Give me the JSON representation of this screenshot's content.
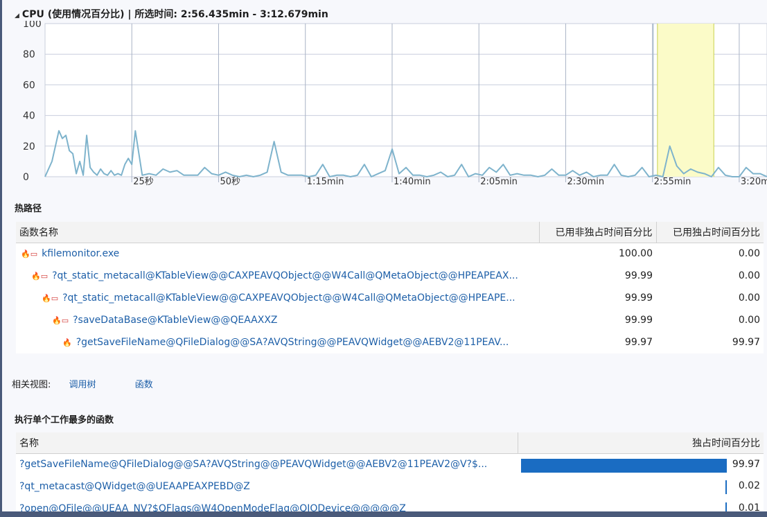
{
  "chart": {
    "title": "CPU (使用情况百分比) | 所选时间: 2:56.435min - 3:12.679min",
    "y_ticks": [
      "100",
      "80",
      "60",
      "40",
      "20",
      "0"
    ],
    "x_ticks": [
      "25秒",
      "50秒",
      "1:15min",
      "1:40min",
      "2:05min",
      "2:30min",
      "2:55min",
      "3:20min"
    ]
  },
  "chart_data": {
    "type": "line",
    "title": "CPU (使用情况百分比)",
    "xlabel": "",
    "ylabel": "",
    "ylim": [
      0,
      100
    ],
    "xlim_seconds": [
      0,
      208
    ],
    "selection_seconds": [
      176.435,
      192.679
    ],
    "x_unit": "seconds",
    "x": [
      0,
      2,
      4,
      5,
      6,
      7,
      8,
      9,
      10,
      11,
      12,
      13,
      14,
      15,
      16,
      17,
      18,
      19,
      20,
      21,
      22,
      23,
      24,
      25,
      26,
      28,
      30,
      32,
      34,
      36,
      38,
      40,
      44,
      46,
      48,
      50,
      52,
      54,
      56,
      58,
      60,
      62,
      64,
      66,
      68,
      70,
      72,
      74,
      76,
      78,
      80,
      82,
      84,
      86,
      88,
      90,
      92,
      94,
      96,
      98,
      100,
      102,
      104,
      106,
      108,
      110,
      112,
      114,
      116,
      118,
      120,
      122,
      124,
      126,
      128,
      130,
      132,
      134,
      136,
      138,
      140,
      142,
      144,
      146,
      148,
      150,
      152,
      154,
      156,
      158,
      160,
      162,
      164,
      166,
      168,
      170,
      172,
      174,
      176,
      178,
      180,
      182,
      184,
      186,
      188,
      190,
      192,
      194,
      196,
      198,
      200,
      202,
      204,
      206,
      208
    ],
    "series": [
      {
        "values": [
          0,
          10,
          30,
          25,
          27,
          17,
          15,
          2,
          10,
          1,
          27,
          6,
          3,
          1,
          5,
          2,
          1,
          4,
          1,
          2,
          1,
          8,
          12,
          8,
          30,
          1,
          2,
          1,
          5,
          3,
          4,
          1,
          1,
          6,
          2,
          1,
          3,
          1,
          0,
          1,
          0,
          1,
          3,
          23,
          3,
          1,
          1,
          1,
          0,
          1,
          8,
          0,
          1,
          1,
          0,
          1,
          8,
          0,
          2,
          4,
          18,
          2,
          6,
          1,
          1,
          0,
          1,
          3,
          0,
          1,
          8,
          0,
          2,
          1,
          6,
          3,
          8,
          1,
          2,
          1,
          1,
          0,
          1,
          5,
          1,
          1,
          4,
          1,
          3,
          0,
          1,
          1,
          8,
          1,
          0,
          1,
          6,
          0,
          1,
          0,
          20,
          7,
          2,
          5,
          3,
          2,
          0,
          6,
          1,
          0,
          0,
          6,
          2,
          2,
          0
        ]
      }
    ]
  },
  "hotpath": {
    "title": "热路径",
    "columns": [
      "函数名称",
      "已用非独占时间百分比",
      "已用独占时间百分比"
    ],
    "rows": [
      {
        "name": "kfilemonitor.exe",
        "inclusive": "100.00",
        "exclusive": "0.00"
      },
      {
        "name": "?qt_static_metacall@KTableView@@CAXPEAVQObject@@W4Call@QMetaObject@@HPEAPEAX...",
        "inclusive": "99.99",
        "exclusive": "0.00"
      },
      {
        "name": "?qt_static_metacall@KTableView@@CAXPEAVQObject@@W4Call@QMetaObject@@HPEAPE...",
        "inclusive": "99.99",
        "exclusive": "0.00"
      },
      {
        "name": "?saveDataBase@KTableView@@QEAAXXZ",
        "inclusive": "99.99",
        "exclusive": "0.00"
      },
      {
        "name": "?getSaveFileName@QFileDialog@@SA?AVQString@@PEAVQWidget@@AEBV2@11PEAV...",
        "inclusive": "99.97",
        "exclusive": "99.97"
      }
    ]
  },
  "related": {
    "label": "相关视图:",
    "call_tree": "调用树",
    "functions": "函数"
  },
  "topfuncs": {
    "title": "执行单个工作最多的函数",
    "columns": [
      "名称",
      "独占时间百分比"
    ],
    "rows": [
      {
        "name": "?getSaveFileName@QFileDialog@@SA?AVQString@@PEAVQWidget@@AEBV2@11PEAV2@V?$...",
        "value": "99.97",
        "fraction": 0.9997
      },
      {
        "name": "?qt_metacast@QWidget@@UEAAPEAXPEBD@Z",
        "value": "0.02",
        "fraction": 0.0002
      },
      {
        "name": "?open@QFile@@UEAA_NV?$QFlags@W4OpenModeFlag@QIODevice@@@@@Z",
        "value": "0.01",
        "fraction": 0.0001
      }
    ]
  },
  "colors": {
    "line": "#7eb3cc",
    "selection": "#fbfbc8",
    "selection_edge": "#c8d24b",
    "bar": "#1a6cc2",
    "link": "#1d5fa8"
  }
}
